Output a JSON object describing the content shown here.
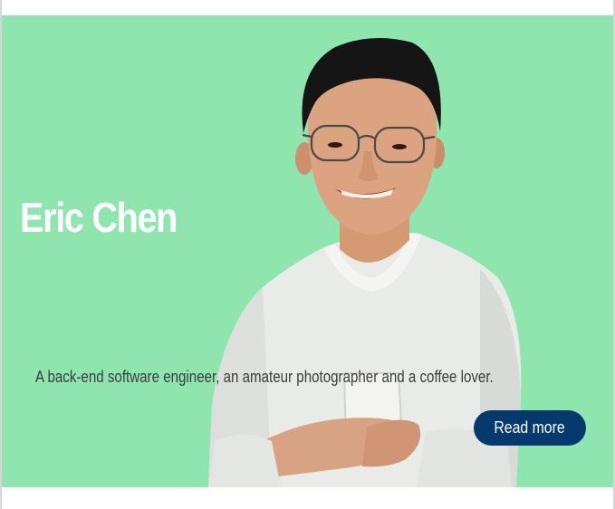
{
  "profile": {
    "name": "Eric Chen",
    "tagline": "A back-end software engineer, an amateur photographer and a coffee lover.",
    "read_more_label": "Read more"
  },
  "colors": {
    "hero_background": "#8ee5ae",
    "name_text": "#ffffff",
    "tagline_text": "#3d3d3d",
    "button_background": "#063a6e",
    "button_text": "#ffffff"
  },
  "icons": {
    "portrait": "person-portrait"
  }
}
